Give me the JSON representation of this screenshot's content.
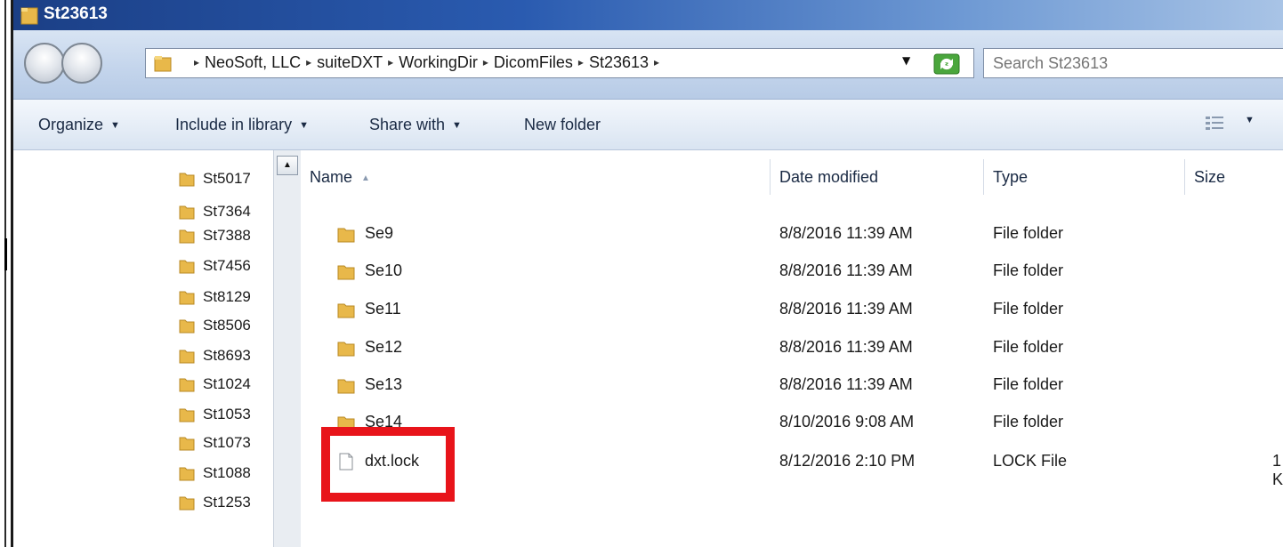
{
  "window": {
    "title": "St23613"
  },
  "address": {
    "crumbs": [
      "NeoSoft, LLC",
      "suiteDXT",
      "WorkingDir",
      "DicomFiles",
      "St23613"
    ]
  },
  "search": {
    "placeholder": "Search St23613"
  },
  "toolbar": {
    "organize": "Organize",
    "include_in_library": "Include in library",
    "share_with": "Share with",
    "new_folder": "New folder"
  },
  "nav_pane": {
    "items": [
      "St5017",
      "St7364",
      "St7388",
      "St7456",
      "St8129",
      "St8506",
      "St8693",
      "St1024",
      "St1053",
      "St1073",
      "St1088",
      "St1253"
    ]
  },
  "columns": {
    "name": "Name",
    "date_modified": "Date modified",
    "type": "Type",
    "size": "Size"
  },
  "files": [
    {
      "name": "Se9",
      "date": "8/8/2016 11:39 AM",
      "type": "File folder",
      "size": ""
    },
    {
      "name": "Se10",
      "date": "8/8/2016 11:39 AM",
      "type": "File folder",
      "size": ""
    },
    {
      "name": "Se11",
      "date": "8/8/2016 11:39 AM",
      "type": "File folder",
      "size": ""
    },
    {
      "name": "Se12",
      "date": "8/8/2016 11:39 AM",
      "type": "File folder",
      "size": ""
    },
    {
      "name": "Se13",
      "date": "8/8/2016 11:39 AM",
      "type": "File folder",
      "size": ""
    },
    {
      "name": "Se14",
      "date": "8/10/2016 9:08 AM",
      "type": "File folder",
      "size": ""
    },
    {
      "name": "dxt.lock",
      "date": "8/12/2016 2:10 PM",
      "type": "LOCK File",
      "size": "1 K"
    }
  ],
  "colors": {
    "highlight": "#e8141a",
    "titlebar": "#1b3f86",
    "folder": "#e8b84a"
  }
}
